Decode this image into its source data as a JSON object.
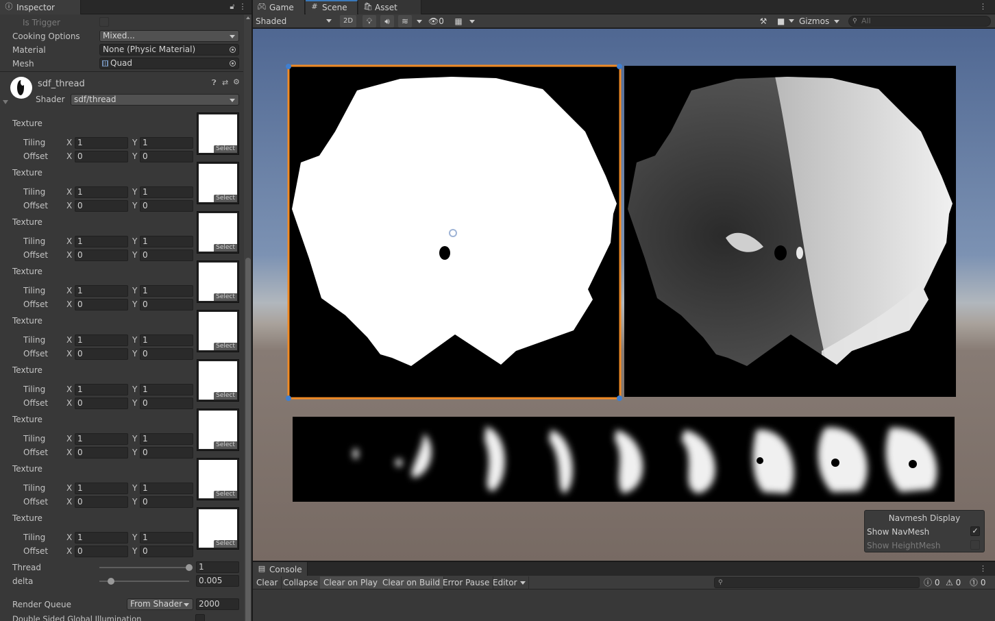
{
  "inspector": {
    "tab_label": "Inspector",
    "tab_icon": "info-icon",
    "rows": {
      "is_trigger": "Is Trigger",
      "cooking_options": {
        "label": "Cooking Options",
        "value": "Mixed..."
      },
      "material": {
        "label": "Material",
        "value": "None (Physic Material)"
      },
      "mesh": {
        "label": "Mesh",
        "value": "Quad"
      }
    },
    "material_header": {
      "name": "sdf_thread",
      "shader_label": "Shader",
      "shader_value": "sdf/thread"
    },
    "texture_props": [
      {
        "label": "Texture",
        "tiling_label": "Tiling",
        "offset_label": "Offset",
        "tiling_x": "1",
        "tiling_y": "1",
        "offset_x": "0",
        "offset_y": "0",
        "select": "Select"
      },
      {
        "label": "Texture",
        "tiling_label": "Tiling",
        "offset_label": "Offset",
        "tiling_x": "1",
        "tiling_y": "1",
        "offset_x": "0",
        "offset_y": "0",
        "select": "Select"
      },
      {
        "label": "Texture",
        "tiling_label": "Tiling",
        "offset_label": "Offset",
        "tiling_x": "1",
        "tiling_y": "1",
        "offset_x": "0",
        "offset_y": "0",
        "select": "Select"
      },
      {
        "label": "Texture",
        "tiling_label": "Tiling",
        "offset_label": "Offset",
        "tiling_x": "1",
        "tiling_y": "1",
        "offset_x": "0",
        "offset_y": "0",
        "select": "Select"
      },
      {
        "label": "Texture",
        "tiling_label": "Tiling",
        "offset_label": "Offset",
        "tiling_x": "1",
        "tiling_y": "1",
        "offset_x": "0",
        "offset_y": "0",
        "select": "Select"
      },
      {
        "label": "Texture",
        "tiling_label": "Tiling",
        "offset_label": "Offset",
        "tiling_x": "1",
        "tiling_y": "1",
        "offset_x": "0",
        "offset_y": "0",
        "select": "Select"
      },
      {
        "label": "Texture",
        "tiling_label": "Tiling",
        "offset_label": "Offset",
        "tiling_x": "1",
        "tiling_y": "1",
        "offset_x": "0",
        "offset_y": "0",
        "select": "Select"
      },
      {
        "label": "Texture",
        "tiling_label": "Tiling",
        "offset_label": "Offset",
        "tiling_x": "1",
        "tiling_y": "1",
        "offset_x": "0",
        "offset_y": "0",
        "select": "Select"
      },
      {
        "label": "Texture",
        "tiling_label": "Tiling",
        "offset_label": "Offset",
        "tiling_x": "1",
        "tiling_y": "1",
        "offset_x": "0",
        "offset_y": "0",
        "select": "Select"
      }
    ],
    "axis_x": "X",
    "axis_y": "Y",
    "thread": {
      "label": "Thread",
      "value": "1",
      "fraction": 1.0
    },
    "delta": {
      "label": "delta",
      "value": "0.005",
      "fraction": 0.13
    },
    "render_queue": {
      "label": "Render Queue",
      "mode": "From Shader",
      "value": "2000"
    },
    "double_sided": "Double Sided Global Illumination"
  },
  "scene": {
    "tabs": [
      {
        "label": "Game",
        "icon": "gamepad-icon"
      },
      {
        "label": "Scene",
        "icon": "grid-icon"
      },
      {
        "label": "Asset Store",
        "icon": "store-icon"
      }
    ],
    "toolbar": {
      "shading_mode": "Shaded",
      "two_d": "2D",
      "hidden_count": "0",
      "gizmos": "Gizmos",
      "search_placeholder": "All"
    },
    "navmesh": {
      "title": "Navmesh Display",
      "show_navmesh": "Show NavMesh",
      "show_heightmesh": "Show HeightMesh"
    }
  },
  "console": {
    "tab_label": "Console",
    "buttons": {
      "clear": "Clear",
      "collapse": "Collapse",
      "clear_on_play": "Clear on Play",
      "clear_on_build": "Clear on Build",
      "error_pause": "Error Pause",
      "editor": "Editor"
    },
    "counts": {
      "info": "0",
      "warning": "0",
      "error": "0"
    }
  },
  "colors": {
    "selection_outline": "#f08a24",
    "active_tab_accent": "#3a79bb"
  }
}
